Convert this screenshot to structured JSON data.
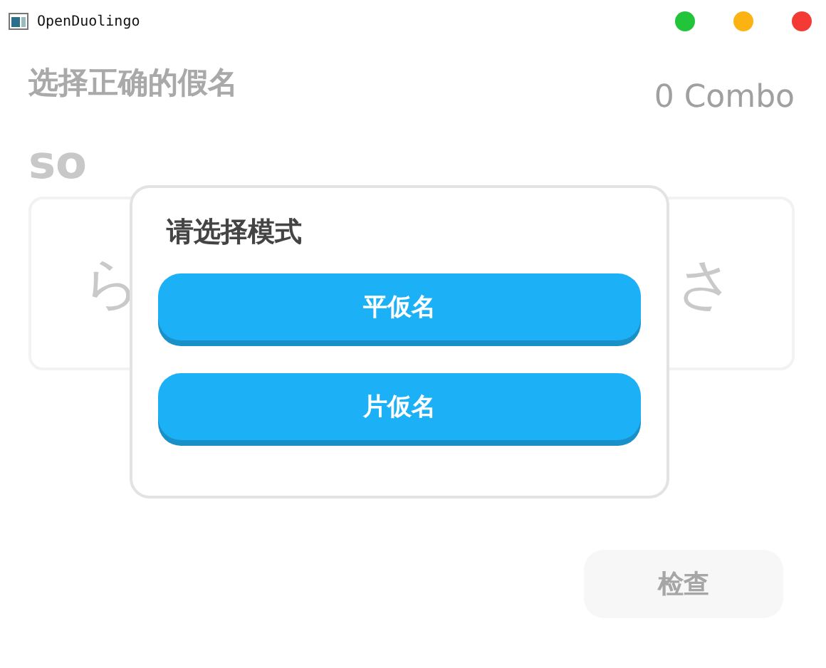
{
  "window": {
    "title": "OpenDuolingo",
    "controls": [
      {
        "color": "#22c43a"
      },
      {
        "color": "#fbb314"
      },
      {
        "color": "#f33a35"
      }
    ]
  },
  "prompt": "选择正确的假名",
  "combo": "0 Combo",
  "romaji": "so",
  "options": [
    "ら",
    "さ"
  ],
  "check_button": {
    "label": "检查",
    "disabled": true
  },
  "dialog": {
    "title": "请选择模式",
    "buttons": [
      "平仮名",
      "片仮名"
    ]
  }
}
